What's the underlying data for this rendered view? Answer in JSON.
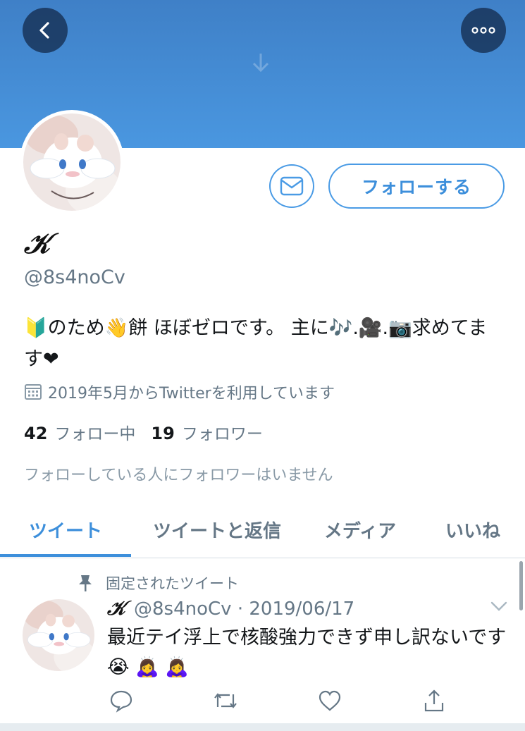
{
  "header": {
    "back_icon": "chevron-left-icon",
    "more_icon": "more-dots-icon"
  },
  "profile": {
    "display_name": "𝒦",
    "handle": "@8s4noCv",
    "bio": "🔰のため👋餅 ほぼゼロです。 主に🎶.🎥.📷求めてます❤",
    "joined": "2019年5月からTwitterを利用しています",
    "following_count": "42",
    "following_label": "フォロー中",
    "followers_count": "19",
    "followers_label": "フォロワー",
    "no_followers_note": "フォローしている人にフォロワーはいません",
    "follow_button_label": "フォローする",
    "message_icon": "mail-icon"
  },
  "tabs": [
    {
      "label": "ツイート",
      "active": true
    },
    {
      "label": "ツイートと返信",
      "active": false
    },
    {
      "label": "メディア",
      "active": false
    },
    {
      "label": "いいね",
      "active": false
    }
  ],
  "pinned_tweet": {
    "pinned_label": "固定されたツイート",
    "name": "𝒦",
    "handle_date": "@8s4noCv · 2019/06/17",
    "text": "最近テイ浮上で核酸強力できず申し訳ないです😭 🙇‍♀️ 🙇‍♀️",
    "actions": [
      "reply-icon",
      "retweet-icon",
      "like-icon",
      "share-icon"
    ]
  },
  "colors": {
    "accent": "#3d8fdb",
    "banner": "#4a97e0",
    "secondary_text": "#657786"
  }
}
